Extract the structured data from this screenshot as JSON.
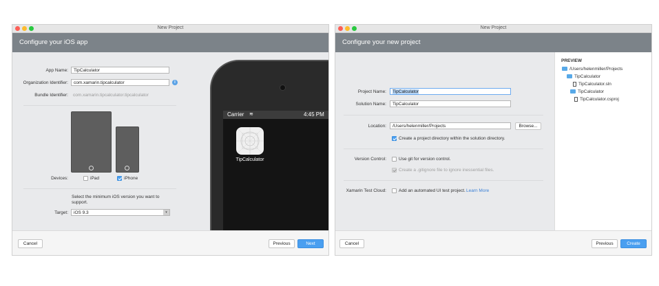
{
  "left_window": {
    "title": "New Project",
    "header": "Configure your iOS app",
    "fields": {
      "app_name_label": "App Name:",
      "app_name_value": "TipCalculator",
      "org_id_label": "Organization Identifier:",
      "org_id_value": "com.xamarin.tipcalculator",
      "bundle_id_label": "Bundle Identifier:",
      "bundle_id_value": "com.xamarin.tipcalculator.tipcalculator"
    },
    "devices": {
      "label": "Devices:",
      "ipad_label": "iPad",
      "ipad_checked": false,
      "iphone_label": "iPhone",
      "iphone_checked": true
    },
    "target": {
      "hint": "Select the minimum iOS version you want to support.",
      "label": "Target:",
      "value": "iOS 9.3"
    },
    "phone": {
      "carrier": "Carrier",
      "time": "4:45 PM",
      "app_label": "TipCalculator"
    },
    "buttons": {
      "cancel": "Cancel",
      "previous": "Previous",
      "next": "Next"
    }
  },
  "right_window": {
    "title": "New Project",
    "header": "Configure your new project",
    "fields": {
      "project_name_label": "Project Name:",
      "project_name_value": "TipCalculator",
      "solution_name_label": "Solution Name:",
      "solution_name_value": "TipCalculator",
      "location_label": "Location:",
      "location_value": "/Users/helenmiller/Projects",
      "browse": "Browse...",
      "create_dir_label": "Create a project directory within the solution directory.",
      "create_dir_checked": true
    },
    "version_control": {
      "label": "Version Control:",
      "use_git_label": "Use git for version control.",
      "use_git_checked": false,
      "gitignore_label": "Create a .gitignore file to ignore inessential files.",
      "gitignore_checked": true
    },
    "test_cloud": {
      "label": "Xamarin Test Cloud:",
      "add_test_label": "Add an automated UI test project.",
      "learn_more": "Learn More",
      "checked": false
    },
    "preview": {
      "title": "PREVIEW",
      "items": [
        {
          "label": "/Users/helenmiller/Projects",
          "icon": "folder-icon"
        },
        {
          "label": "TipCalculator",
          "icon": "folder-icon"
        },
        {
          "label": "TipCalculator.sln",
          "icon": "file-icon"
        },
        {
          "label": "TipCalculator",
          "icon": "folder-icon"
        },
        {
          "label": "TipCalculator.csproj",
          "icon": "file-icon"
        }
      ]
    },
    "buttons": {
      "cancel": "Cancel",
      "previous": "Previous",
      "create": "Create"
    }
  },
  "colors": {
    "header_bg": "#7c8389",
    "accent": "#4a9ff0",
    "close": "#fc5f57",
    "minimize": "#fdbc2e",
    "zoom": "#29c940"
  }
}
